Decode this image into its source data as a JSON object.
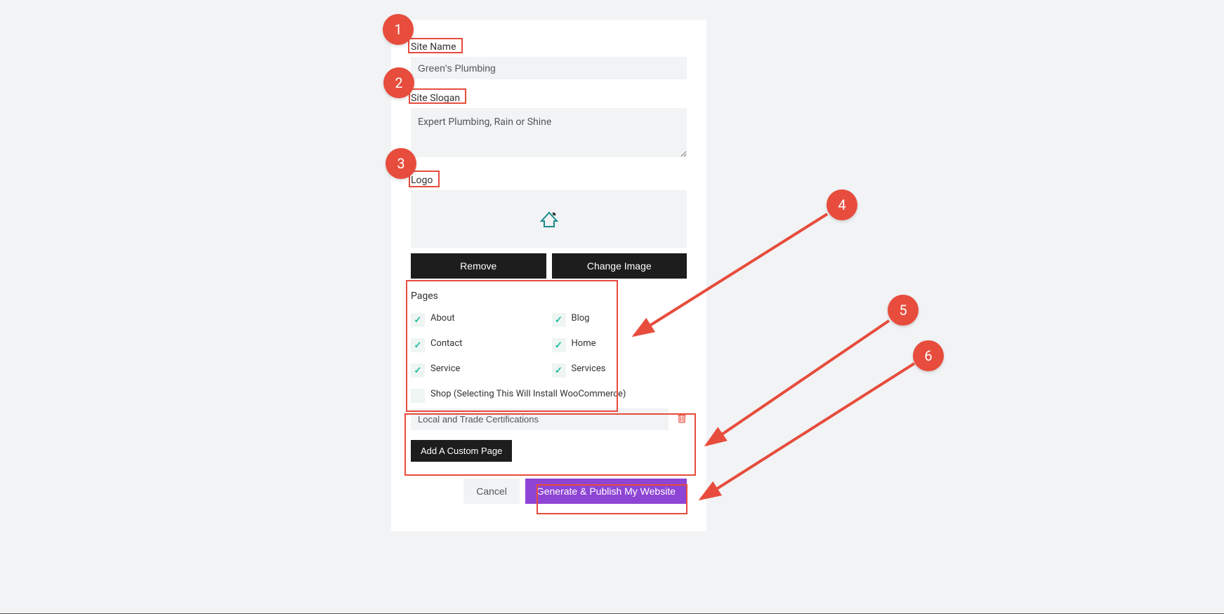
{
  "annotations": {
    "n1": "1",
    "n2": "2",
    "n3": "3",
    "n4": "4",
    "n5": "5",
    "n6": "6"
  },
  "form": {
    "siteName": {
      "label": "Site Name",
      "value": "Green's Plumbing"
    },
    "siteSlogan": {
      "label": "Site Slogan",
      "value": "Expert Plumbing, Rain or Shine"
    },
    "logo": {
      "label": "Logo",
      "removeLabel": "Remove",
      "changeLabel": "Change Image"
    },
    "pages": {
      "label": "Pages",
      "items": [
        {
          "label": "About",
          "checked": true
        },
        {
          "label": "Blog",
          "checked": true
        },
        {
          "label": "Contact",
          "checked": true
        },
        {
          "label": "Home",
          "checked": true
        },
        {
          "label": "Service",
          "checked": true
        },
        {
          "label": "Services",
          "checked": true
        },
        {
          "label": "Shop (Selecting This Will Install WooCommerce)",
          "checked": false,
          "full": true
        }
      ]
    },
    "customPage": {
      "value": "Local and Trade Certifications",
      "addLabel": "Add A Custom Page"
    },
    "footer": {
      "cancel": "Cancel",
      "submit": "Generate & Publish My Website"
    }
  }
}
